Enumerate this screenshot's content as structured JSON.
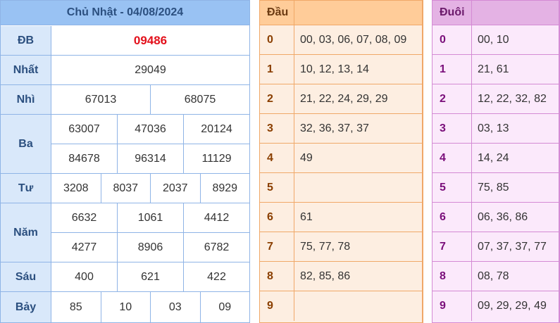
{
  "results": {
    "title": "Chủ Nhật - 04/08/2024",
    "rows": [
      {
        "label": "ĐB",
        "lines": [
          [
            "09486"
          ]
        ]
      },
      {
        "label": "Nhất",
        "lines": [
          [
            "29049"
          ]
        ]
      },
      {
        "label": "Nhì",
        "lines": [
          [
            "67013",
            "68075"
          ]
        ]
      },
      {
        "label": "Ba",
        "lines": [
          [
            "63007",
            "47036",
            "20124"
          ],
          [
            "84678",
            "96314",
            "11129"
          ]
        ]
      },
      {
        "label": "Tư",
        "lines": [
          [
            "3208",
            "8037",
            "2037",
            "8929"
          ]
        ]
      },
      {
        "label": "Năm",
        "lines": [
          [
            "6632",
            "1061",
            "4412"
          ],
          [
            "4277",
            "8906",
            "6782"
          ]
        ]
      },
      {
        "label": "Sáu",
        "lines": [
          [
            "400",
            "621",
            "422"
          ]
        ]
      },
      {
        "label": "Bảy",
        "lines": [
          [
            "85",
            "10",
            "03",
            "09"
          ]
        ]
      }
    ]
  },
  "dau": {
    "header": "Đầu",
    "rows": [
      {
        "k": "0",
        "v": "00, 03, 06, 07, 08, 09"
      },
      {
        "k": "1",
        "v": "10, 12, 13, 14"
      },
      {
        "k": "2",
        "v": "21, 22, 24, 29, 29"
      },
      {
        "k": "3",
        "v": "32, 36, 37, 37"
      },
      {
        "k": "4",
        "v": "49"
      },
      {
        "k": "5",
        "v": ""
      },
      {
        "k": "6",
        "v": "61"
      },
      {
        "k": "7",
        "v": "75, 77, 78"
      },
      {
        "k": "8",
        "v": "82, 85, 86"
      },
      {
        "k": "9",
        "v": ""
      }
    ]
  },
  "duoi": {
    "header": "Đuôi",
    "rows": [
      {
        "k": "0",
        "v": "00, 10"
      },
      {
        "k": "1",
        "v": "21, 61"
      },
      {
        "k": "2",
        "v": "12, 22, 32, 82"
      },
      {
        "k": "3",
        "v": "03, 13"
      },
      {
        "k": "4",
        "v": "14, 24"
      },
      {
        "k": "5",
        "v": "75, 85"
      },
      {
        "k": "6",
        "v": "06, 36, 86"
      },
      {
        "k": "7",
        "v": "07, 37, 37, 77"
      },
      {
        "k": "8",
        "v": "08, 78"
      },
      {
        "k": "9",
        "v": "09, 29, 29, 49"
      }
    ]
  },
  "colors": {
    "special_prize": "#e3101b",
    "results_header": "#99c2f3",
    "dau_header": "#ffcc99",
    "duoi_header": "#e4b2e4"
  }
}
